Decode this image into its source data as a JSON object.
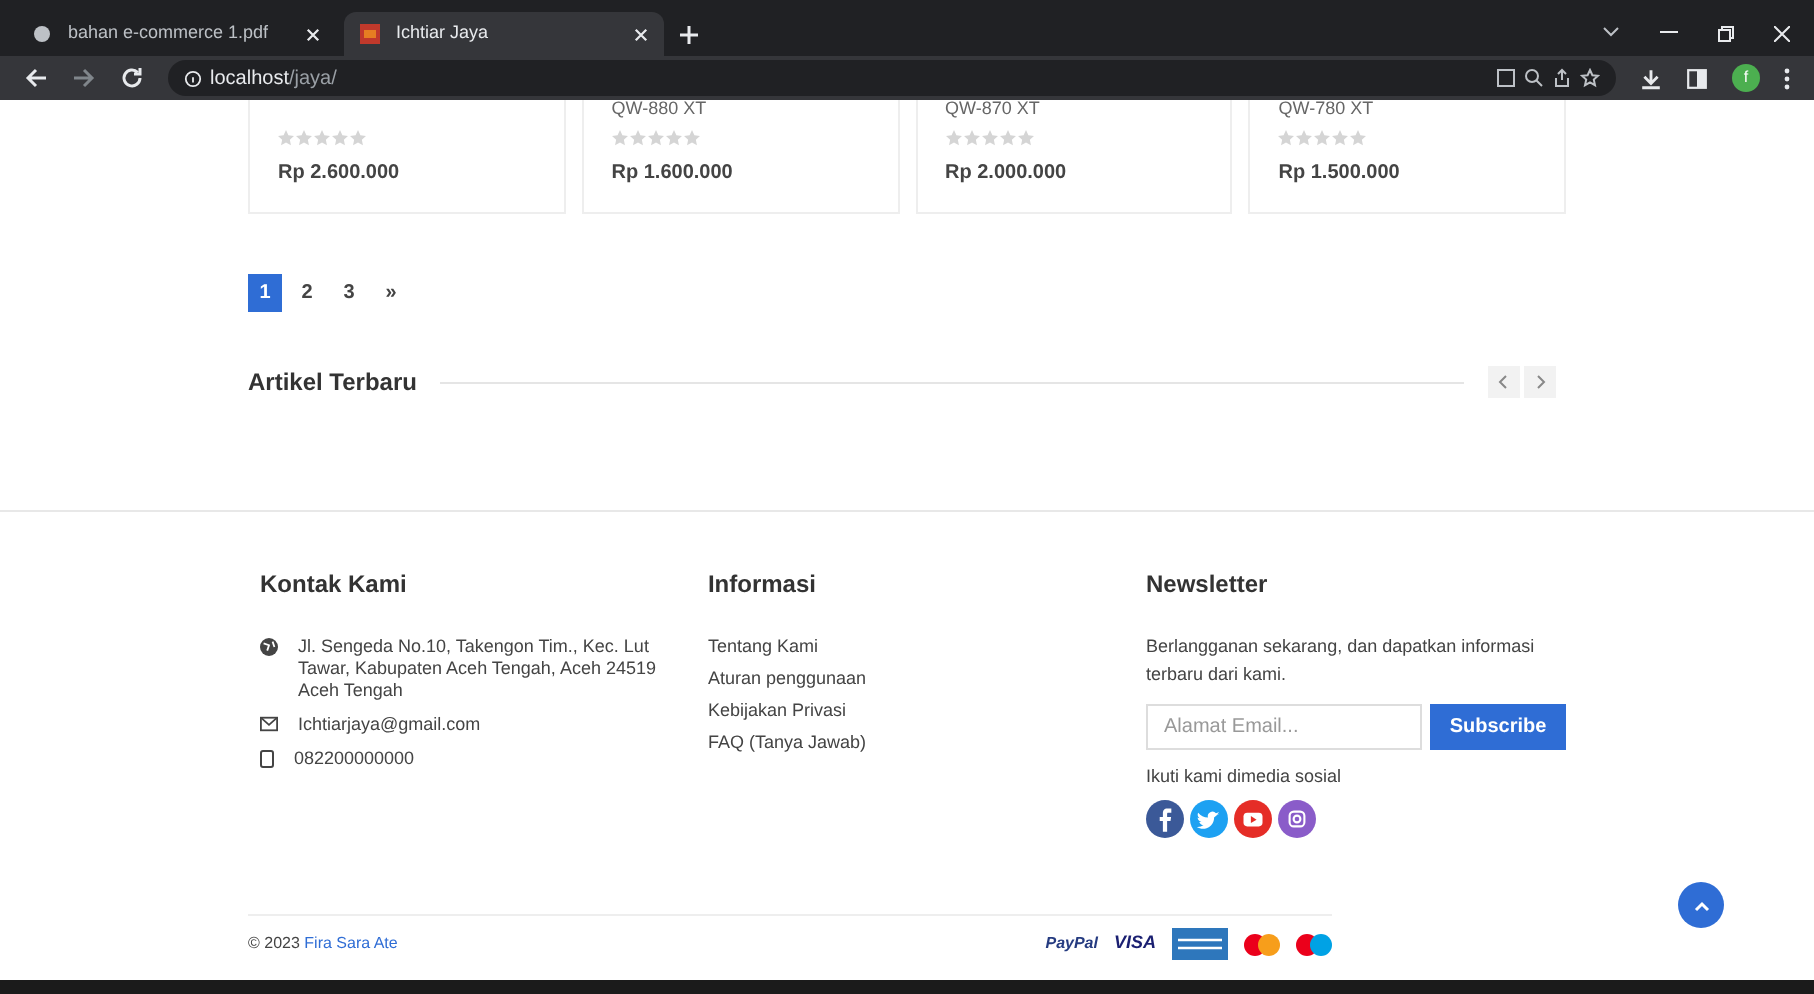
{
  "browser": {
    "tabs": [
      {
        "title": "bahan e-commerce 1.pdf",
        "selected": false
      },
      {
        "title": "Ichtiar Jaya",
        "selected": true
      }
    ],
    "url_host": "localhost",
    "url_path": "/jaya/",
    "profile_initial": "f"
  },
  "products": [
    {
      "stars": 0,
      "price": "Rp 2.600.000"
    },
    {
      "name": "QW-880 XT",
      "stars": 0,
      "price": "Rp 1.600.000"
    },
    {
      "name": "QW-870 XT",
      "stars": 0,
      "price": "Rp 2.000.000"
    },
    {
      "name": "QW-780 XT",
      "stars": 0,
      "price": "Rp 1.500.000"
    }
  ],
  "pagination": [
    {
      "label": "1",
      "selected": true
    },
    {
      "label": "2",
      "selected": false
    },
    {
      "label": "3",
      "selected": false
    },
    {
      "label": "»",
      "selected": false
    }
  ],
  "articles": {
    "title": "Artikel Terbaru"
  },
  "footer": {
    "contact": {
      "title": "Kontak Kami",
      "items": [
        {
          "kind": "address",
          "text": "Jl. Sengeda No.10, Takengon Tim., Kec. Lut Tawar, Kabupaten Aceh Tengah, Aceh 24519 Aceh Tengah"
        },
        {
          "kind": "email",
          "text": "Ichtiarjaya@gmail.com"
        },
        {
          "kind": "phone",
          "text": "082200000000"
        }
      ]
    },
    "info": {
      "title": "Informasi",
      "links": [
        "Tentang Kami",
        "Aturan penggunaan",
        "Kebijakan Privasi",
        "FAQ (Tanya Jawab)"
      ]
    },
    "newsletter": {
      "title": "Newsletter",
      "text": "Berlangganan sekarang, dan dapatkan informasi terbaru dari kami.",
      "placeholder": "Alamat Email...",
      "button": "Subscribe",
      "social_label": "Ikuti kami dimedia sosial",
      "social": [
        {
          "kind": "facebook",
          "color": "#3b5998"
        },
        {
          "kind": "twitter",
          "color": "#1da1f2"
        },
        {
          "kind": "youtube",
          "color": "#e52d27"
        },
        {
          "kind": "instagram",
          "color": "#8a5cc9"
        }
      ]
    },
    "copyright": "© 2023",
    "author": "Fira Sara Ate",
    "payments": [
      {
        "kind": "paypal",
        "label": "PayPal"
      },
      {
        "kind": "visa",
        "label": "VISA"
      },
      {
        "kind": "amex"
      },
      {
        "kind": "mastercard"
      },
      {
        "kind": "maestro"
      }
    ]
  }
}
